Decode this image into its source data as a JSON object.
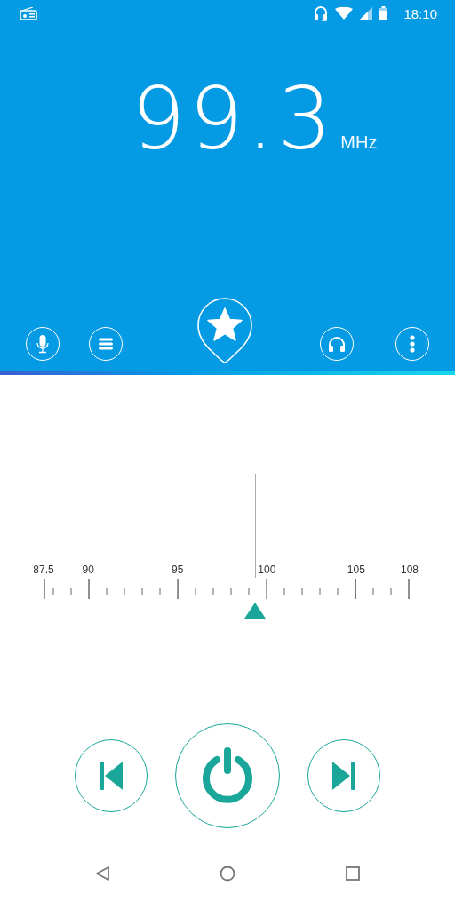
{
  "status_bar": {
    "time": "18:10"
  },
  "tuner": {
    "frequency": "99.3",
    "unit": "MHz",
    "favorite": true
  },
  "scale": {
    "labels": [
      "87.5",
      "90",
      "95",
      "100",
      "105",
      "108"
    ]
  }
}
